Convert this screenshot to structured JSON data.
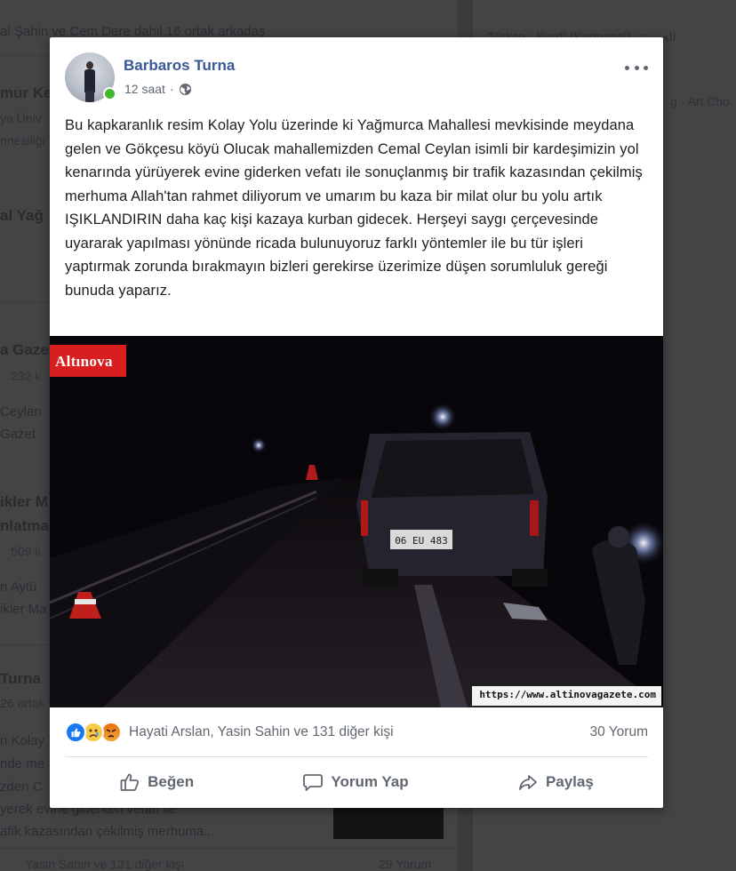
{
  "background": {
    "feed_lines": [
      {
        "text": "al Şahin ve Cem Dere dahil 16 ortak arkadaş",
        "style": "norm"
      },
      {
        "text": "mur Ke",
        "style": "bold"
      },
      {
        "text": "ya Üniv",
        "style": "small"
      },
      {
        "text": "nnesiliği",
        "style": "small"
      },
      {
        "text": "al Yağ",
        "style": "bold"
      },
      {
        "text": "a Gaze",
        "style": "bold"
      },
      {
        "text": "232 k",
        "style": "small"
      },
      {
        "text": "Ceylan",
        "style": "norm"
      },
      {
        "text": "Gazet",
        "style": "norm"
      },
      {
        "text": "ikler M",
        "style": "bold"
      },
      {
        "text": "nlatma",
        "style": "bold"
      },
      {
        "text": "509 k",
        "style": "small"
      },
      {
        "text": "n Aytü",
        "style": "norm"
      },
      {
        "text": "ikler Ma",
        "style": "norm"
      },
      {
        "text": "Turna",
        "style": "bold"
      },
      {
        "text": "26 ortak",
        "style": "small"
      },
      {
        "text": "n Kolay",
        "style": "norm"
      },
      {
        "text": "nde me",
        "style": "norm"
      },
      {
        "text": "zden C",
        "style": "norm"
      },
      {
        "text": "yerek evine giderken vefatı ile",
        "style": "norm"
      },
      {
        "text": "afik kazasından çekilmiş merhuma...",
        "style": "norm"
      },
      {
        "text": "Yasin Sahin ve 131 diğer kişi",
        "style": "small"
      },
      {
        "text": "29 Yorum",
        "style": "small"
      }
    ],
    "right_lines": [
      {
        "text": "Türkçe · Kurdî (Kurmancî) · العربية"
      },
      {
        "text": "g · Art Cho"
      }
    ]
  },
  "post": {
    "author": "Barbaros Turna",
    "time": "12 saat",
    "separator": "·",
    "privacy_icon": "globe-icon",
    "text": "Bu kapkaranlık resim Kolay Yolu üzerinde ki Yağmurca Mahallesi mevkisinde meydana gelen ve Gökçesu köyü Olucak mahallemizden Cemal Ceylan isimli bir kardeşimizin yol kenarında yürüyerek evine giderken vefatı ile sonuçlanmış bir trafik kazasından çekilmiş merhuma Allah'tan rahmet diliyorum ve umarım bu kaza bir milat olur bu yolu artık IŞIKLANDIRIN daha kaç kişi kazaya kurban gidecek. Herşeyi saygı çerçevesinde uyararak yapılması yönünde ricada bulunuyoruz farklı yöntemler ile bu tür işleri yaptırmak zorunda bırakmayın bizleri gerekirse üzerimize düşen sorumluluk gereği bunuda yaparız.",
    "photo": {
      "logo_text": "Altınova",
      "watermark_url": "https://www.altinovagazete.com",
      "plate_text": "06 EU 483"
    },
    "reactions": {
      "icons": [
        "like-icon",
        "sad-icon",
        "angry-icon"
      ],
      "names": "Hayati Arslan, Yasin Sahin ve 131 diğer kişi",
      "comment_count": "30 Yorum"
    },
    "actions": {
      "like": "Beğen",
      "comment": "Yorum Yap",
      "share": "Paylaş"
    }
  },
  "colors": {
    "link_blue": "#385898",
    "meta_gray": "#606770",
    "online_green": "#42b72a",
    "logo_red": "#d81e1e"
  }
}
